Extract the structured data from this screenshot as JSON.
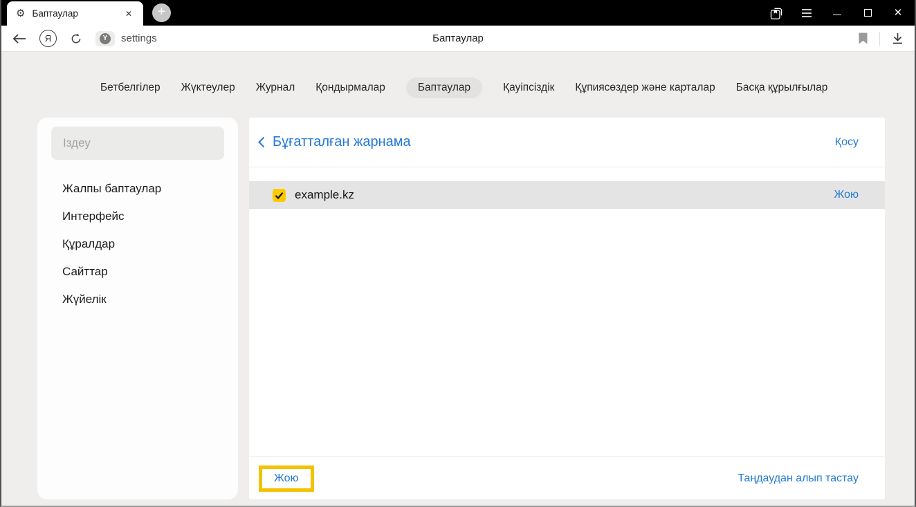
{
  "window": {
    "tab_title": "Баптаулар"
  },
  "toolbar": {
    "url_text": "settings",
    "page_title": "Баптаулар"
  },
  "nav_tabs": [
    {
      "label": "Бетбелгілер",
      "active": false
    },
    {
      "label": "Жүктеулер",
      "active": false
    },
    {
      "label": "Журнал",
      "active": false
    },
    {
      "label": "Қондырмалар",
      "active": false
    },
    {
      "label": "Баптаулар",
      "active": true
    },
    {
      "label": "Қауіпсіздік",
      "active": false
    },
    {
      "label": "Құпиясөздер және карталар",
      "active": false
    },
    {
      "label": "Басқа құрылғылар",
      "active": false
    }
  ],
  "sidebar": {
    "search_placeholder": "Іздеу",
    "items": [
      {
        "label": "Жалпы баптаулар"
      },
      {
        "label": "Интерфейс"
      },
      {
        "label": "Құралдар"
      },
      {
        "label": "Сайттар"
      },
      {
        "label": "Жүйелік"
      }
    ]
  },
  "main": {
    "title": "Бұғатталған жарнама",
    "add_link": "Қосу",
    "list": [
      {
        "domain": "example.kz",
        "checked": true,
        "action_label": "Жою"
      }
    ],
    "footer": {
      "delete_label": "Жою",
      "deselect_label": "Таңдаудан алып тастау"
    }
  },
  "colors": {
    "link_blue": "#2379d4",
    "checkbox_yellow": "#fdca00",
    "highlight_border": "#f3c200",
    "row_selected_bg": "#e4e4e4",
    "tabbar_bg": "#000000",
    "page_bg": "#efeeed"
  }
}
